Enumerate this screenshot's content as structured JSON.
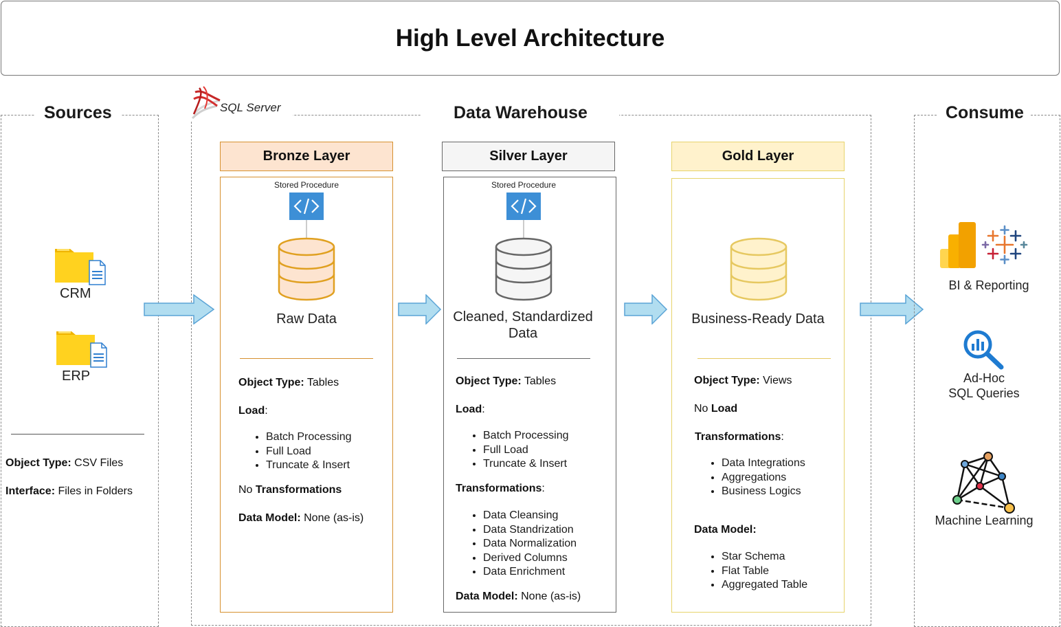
{
  "title": "High Level Architecture",
  "sources": {
    "title": "Sources",
    "items": [
      {
        "label": "CRM",
        "icon": "folder-document-icon"
      },
      {
        "label": "ERP",
        "icon": "folder-document-icon"
      }
    ],
    "object_type_label": "Object Type:",
    "object_type_value": " CSV Files",
    "interface_label": "Interface:",
    "interface_value": " Files in Folders"
  },
  "warehouse": {
    "title": "Data Warehouse",
    "platform": "SQL Server",
    "bronze": {
      "header": "Bronze Layer",
      "stored_procedure": "Stored Procedure",
      "data_label": "Raw Data",
      "object_type_label": "Object Type:",
      "object_type_value": " Tables",
      "load_label": "Load",
      "load_suffix": ":",
      "load_items": [
        "Batch Processing",
        "Full Load",
        "Truncate & Insert"
      ],
      "transform_prefix": "No ",
      "transform_label": "Transformations",
      "data_model_label": "Data Model:",
      "data_model_value": " None (as-is)"
    },
    "silver": {
      "header": "Silver Layer",
      "stored_procedure": "Stored Procedure",
      "data_label_1": "Cleaned, Standardized",
      "data_label_2": "Data",
      "object_type_label": "Object Type:",
      "object_type_value": " Tables",
      "load_label": "Load",
      "load_suffix": ":",
      "load_items": [
        "Batch Processing",
        "Full Load",
        "Truncate & Insert"
      ],
      "transform_label": "Transformations",
      "transform_suffix": ":",
      "transform_items": [
        "Data Cleansing",
        "Data Standrization",
        "Data Normalization",
        "Derived Columns",
        "Data Enrichment"
      ],
      "data_model_label": "Data Model:",
      "data_model_value": " None (as-is)"
    },
    "gold": {
      "header": "Gold Layer",
      "data_label": "Business-Ready Data",
      "object_type_label": "Object Type:",
      "object_type_value": " Views",
      "load_prefix": "No ",
      "load_label": "Load",
      "transform_label": "Transformations",
      "transform_suffix": ":",
      "transform_items": [
        "Data Integrations",
        "Aggregations",
        "Business Logics"
      ],
      "data_model_label": "Data Model:",
      "data_model_items": [
        "Star Schema",
        "Flat Table",
        "Aggregated Table"
      ]
    }
  },
  "consume": {
    "title": "Consume",
    "items": [
      {
        "label": "BI & Reporting",
        "icon": "bi-tools-icon"
      },
      {
        "label_1": "Ad-Hoc",
        "label_2": "SQL Queries",
        "icon": "query-magnifier-icon"
      },
      {
        "label": "Machine Learning",
        "icon": "network-graph-icon"
      }
    ]
  },
  "colors": {
    "bronze_fill": "#fde4d0",
    "bronze_border": "#d6902e",
    "silver_fill": "#f5f5f5",
    "silver_border": "#666666",
    "gold_fill": "#fff2cc",
    "gold_border": "#e6d36b",
    "arrow_fill": "#b1ddf0",
    "arrow_border": "#5aa4d6",
    "procedure_blue": "#3d8fd6"
  }
}
